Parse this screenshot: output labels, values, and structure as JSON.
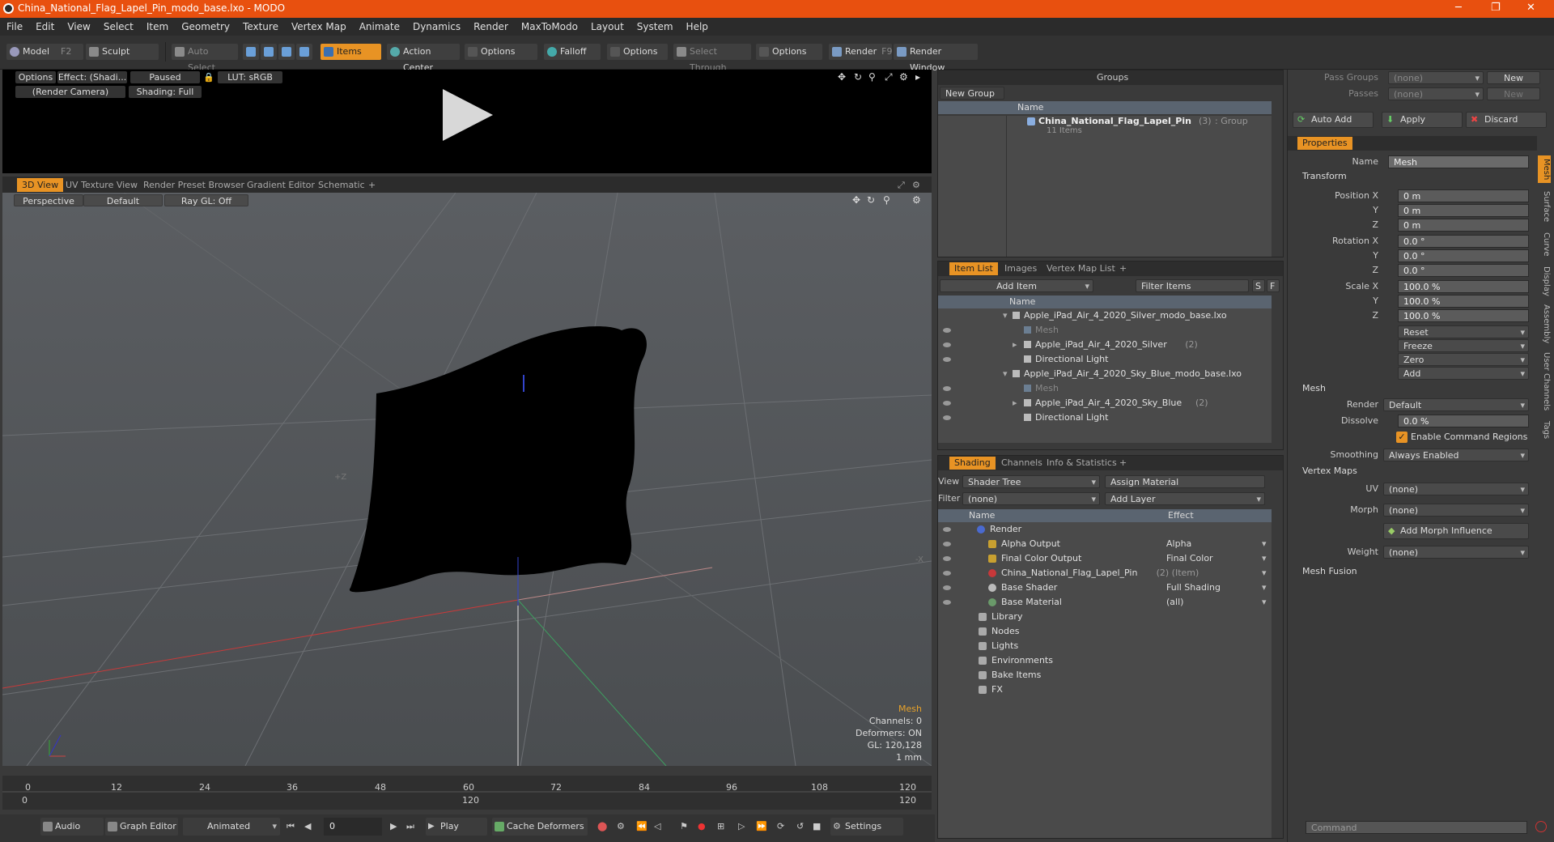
{
  "window": {
    "title": "China_National_Flag_Lapel_Pin_modo_base.lxo - MODO",
    "minimize": "─",
    "restore": "❐",
    "close": "✕"
  },
  "menu": [
    "File",
    "Edit",
    "View",
    "Select",
    "Item",
    "Geometry",
    "Texture",
    "Vertex Map",
    "Animate",
    "Dynamics",
    "Render",
    "MaxToModo",
    "Layout",
    "System",
    "Help"
  ],
  "toolbar": {
    "model": "Model",
    "model_key": "F2",
    "sculpt": "Sculpt",
    "auto_select": "Auto Select",
    "items": "Items",
    "action_center": "Action Center",
    "options1": "Options",
    "falloff": "Falloff",
    "options2": "Options",
    "select_through": "Select Through",
    "options3": "Options",
    "render": "Render",
    "render_key": "F9",
    "render_window": "Render Window"
  },
  "preview": {
    "options": "Options",
    "effect": "Effect: (Shadi...",
    "paused": "Paused",
    "lut": "LUT: sRGB",
    "camera": "(Render Camera)",
    "shading": "Shading: Full"
  },
  "viewport_tabs": [
    "3D View",
    "UV Texture View",
    "Render Preset Browser",
    "Gradient Editor",
    "Schematic",
    "+"
  ],
  "viewport": {
    "perspective": "Perspective",
    "default": "Default",
    "raygl": "Ray GL: Off",
    "plus_z": "+Z",
    "minus_x": "-X"
  },
  "info": {
    "mesh": "Mesh",
    "channels": "Channels: 0",
    "deformers": "Deformers: ON",
    "gl": "GL: 120,128",
    "unit": "1 mm"
  },
  "timeline": {
    "ticks_top": [
      "0",
      "12",
      "24",
      "36",
      "48",
      "60",
      "72",
      "84",
      "96",
      "108",
      "120"
    ],
    "ticks_bottom": [
      "0",
      "120",
      "120"
    ]
  },
  "bottom": {
    "audio": "Audio",
    "graph_editor": "Graph Editor",
    "animated": "Animated",
    "frame": "0",
    "play": "Play",
    "cache": "Cache Deformers",
    "settings": "Settings"
  },
  "groups": {
    "title": "Groups",
    "new_group": "New Group",
    "col_name": "Name",
    "row_name": "China_National_Flag_Lapel_Pin",
    "row_count": "(3)",
    "row_type": ": Group",
    "row_items": "11 Items"
  },
  "items_panel": {
    "tabs": [
      "Item List",
      "Images",
      "Vertex Map List",
      "+"
    ],
    "add_item": "Add Item",
    "filter": "Filter Items",
    "s": "S",
    "f": "F",
    "col_name": "Name",
    "rows": [
      {
        "t": "Apple_iPad_Air_4_2020_Silver_modo_base.lxo",
        "i": 0,
        "dim": false
      },
      {
        "t": "Mesh",
        "i": 1,
        "dim": true
      },
      {
        "t": "Apple_iPad_Air_4_2020_Silver",
        "c": "(2)",
        "i": 1,
        "dim": false
      },
      {
        "t": "Directional Light",
        "i": 1,
        "dim": false
      },
      {
        "t": "Apple_iPad_Air_4_2020_Sky_Blue_modo_base.lxo",
        "i": 0,
        "dim": false
      },
      {
        "t": "Mesh",
        "i": 1,
        "dim": true
      },
      {
        "t": "Apple_iPad_Air_4_2020_Sky_Blue",
        "c": "(2)",
        "i": 1,
        "dim": false
      },
      {
        "t": "Directional Light",
        "i": 1,
        "dim": false
      }
    ]
  },
  "shading": {
    "tabs": [
      "Shading",
      "Channels",
      "Info & Statistics",
      "+"
    ],
    "view_lbl": "View",
    "view_val": "Shader Tree",
    "assign": "Assign Material",
    "filter_lbl": "Filter",
    "filter_val": "(none)",
    "add_layer": "Add Layer",
    "col_name": "Name",
    "col_effect": "Effect",
    "rows": [
      {
        "n": "Render",
        "e": "",
        "i": 0
      },
      {
        "n": "Alpha Output",
        "e": "Alpha",
        "i": 1
      },
      {
        "n": "Final Color Output",
        "e": "Final Color",
        "i": 1
      },
      {
        "n": "China_National_Flag_Lapel_Pin",
        "c": "(2) (Item)",
        "e": "",
        "i": 1
      },
      {
        "n": "Base Shader",
        "e": "Full Shading",
        "i": 1
      },
      {
        "n": "Base Material",
        "e": "(all)",
        "i": 1
      },
      {
        "n": "Library",
        "e": "",
        "i": 0
      },
      {
        "n": "Nodes",
        "e": "",
        "i": 0
      },
      {
        "n": "Lights",
        "e": "",
        "i": 0
      },
      {
        "n": "Environments",
        "e": "",
        "i": 0
      },
      {
        "n": "Bake Items",
        "e": "",
        "i": 0
      },
      {
        "n": "FX",
        "e": "",
        "i": 0
      }
    ]
  },
  "pass": {
    "pass_groups": "Pass Groups",
    "passes": "Passes",
    "none": "(none)",
    "new": "New",
    "auto_add": "Auto Add",
    "apply": "Apply",
    "discard": "Discard"
  },
  "props": {
    "tab": "Properties",
    "name_lbl": "Name",
    "name_val": "Mesh",
    "transform": "Transform",
    "pos_x": "Position X",
    "y": "Y",
    "z": "Z",
    "rot_x": "Rotation X",
    "scale_x": "Scale X",
    "zero_m": "0 m",
    "zero_deg": "0.0 °",
    "hundred": "100.0 %",
    "reset": "Reset",
    "freeze": "Freeze",
    "zero": "Zero",
    "add": "Add",
    "mesh": "Mesh",
    "render_lbl": "Render",
    "render_val": "Default",
    "dissolve_lbl": "Dissolve",
    "dissolve_val": "0.0 %",
    "ecr": "Enable Command Regions",
    "smoothing_lbl": "Smoothing",
    "smoothing_val": "Always Enabled",
    "vertex_maps": "Vertex Maps",
    "uv_lbl": "UV",
    "morph_lbl": "Morph",
    "none": "(none)",
    "add_morph": "Add Morph Influence",
    "weight_lbl": "Weight",
    "mesh_fusion": "Mesh Fusion",
    "command": "Command"
  },
  "side_tabs": [
    "Mesh",
    "Surface",
    "Curve",
    "Display",
    "Assembly",
    "User Channels",
    "Tags"
  ]
}
